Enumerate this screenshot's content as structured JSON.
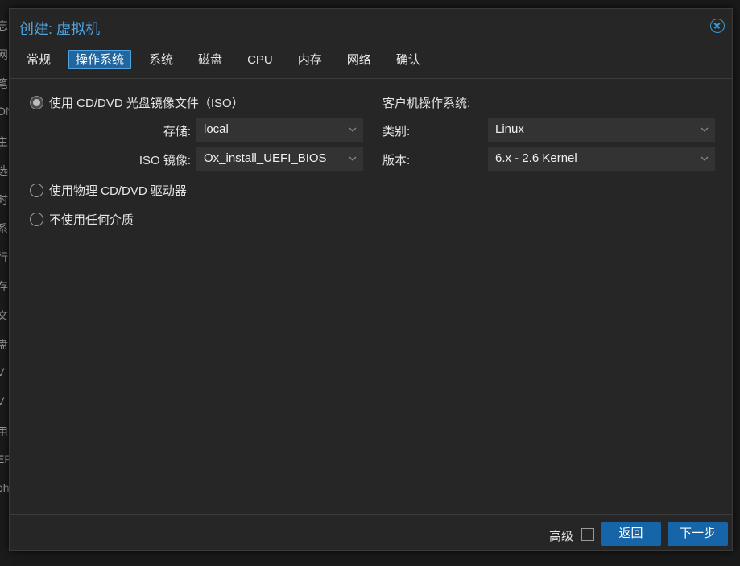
{
  "background_strip": [
    "忘",
    "网",
    "笔",
    "ON",
    "主",
    "选",
    "时",
    "系",
    "行",
    "存",
    "文",
    "盘",
    "V",
    "V",
    "用",
    "EF",
    "oh",
    "."
  ],
  "dialog": {
    "title": "创建: 虚拟机",
    "close_icon": "close-circle-icon"
  },
  "tabs": [
    {
      "label": "常规",
      "active": false
    },
    {
      "label": "操作系统",
      "active": true
    },
    {
      "label": "系统",
      "active": false
    },
    {
      "label": "磁盘",
      "active": false
    },
    {
      "label": "CPU",
      "active": false
    },
    {
      "label": "内存",
      "active": false
    },
    {
      "label": "网络",
      "active": false
    },
    {
      "label": "确认",
      "active": false
    }
  ],
  "media": {
    "iso_option": {
      "label": "使用 CD/DVD 光盘镜像文件（ISO）",
      "checked": true
    },
    "storage": {
      "label": "存储:",
      "value": "local"
    },
    "iso_image": {
      "label": "ISO 镜像:",
      "value": "Ox_install_UEFI_BIOS"
    },
    "physical_option": {
      "label": "使用物理 CD/DVD 驱动器",
      "checked": false
    },
    "none_option": {
      "label": "不使用任何介质",
      "checked": false
    }
  },
  "guest_os": {
    "heading": "客户机操作系统:",
    "type": {
      "label": "类别:",
      "value": "Linux"
    },
    "version": {
      "label": "版本:",
      "value": "6.x - 2.6 Kernel"
    }
  },
  "footer": {
    "advanced_label": "高级",
    "advanced_checked": false,
    "back_label": "返回",
    "next_label": "下一步"
  },
  "colors": {
    "accent": "#4fa3e0",
    "button": "#1565a8",
    "dialog_bg": "#262626",
    "field_bg": "#333333"
  }
}
